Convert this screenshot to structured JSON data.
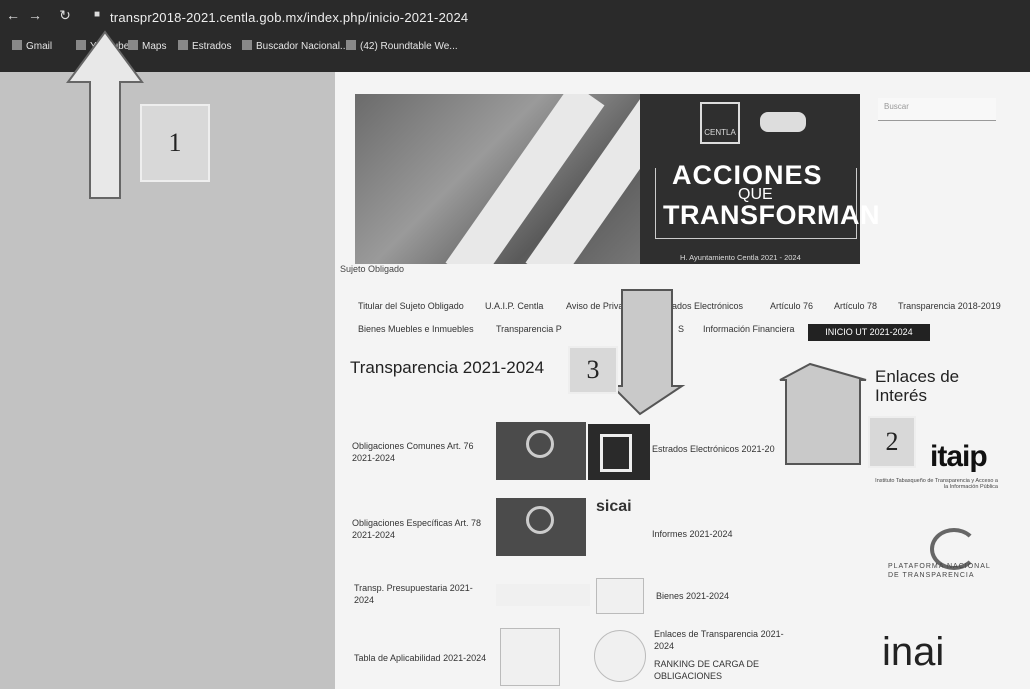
{
  "browser": {
    "url": "transpr2018-2021.centla.gob.mx/index.php/inicio-2021-2024",
    "bookmarks": [
      "Gmail",
      "YouTube",
      "Maps",
      "Estrados",
      "Buscador Nacional...",
      "(42) Roundtable We..."
    ]
  },
  "banner": {
    "line1": "ACCIONES",
    "line2": "QUE",
    "line3": "TRANSFORMAN",
    "footer": "H. Ayuntamiento Centla 2021 - 2024",
    "logo_text": "CENTLA"
  },
  "search": {
    "placeholder": "Buscar"
  },
  "sujeto_label": "Sujeto Obligado",
  "menu": {
    "row1": [
      "Titular del Sujeto Obligado",
      "U.A.I.P. Centla",
      "Aviso de Privac",
      "Estrados Electrónicos",
      "Artículo 76",
      "Artículo 78",
      "Transparencia 2018-2019"
    ],
    "row2": [
      "Bienes Muebles e Inmuebles",
      "Transparencia P",
      "S",
      "Información Financiera"
    ],
    "active": "INICIO UT 2021-2024"
  },
  "page_title": "Transparencia 2021-2024",
  "enlaces_title": "Enlaces de Interés",
  "rows": [
    {
      "left": "Obligaciones Comunes Art. 76 2021-2024",
      "right": "Estrados Electrónicos 2021-20"
    },
    {
      "left": "Obligaciones Específicas Art. 78 2021-2024",
      "right": "Informes 2021-2024"
    },
    {
      "left": "Transp. Presupuestaria 2021-2024",
      "right": "Bienes 2021-2024"
    },
    {
      "left": "Tabla de Aplicabilidad 2021-2024",
      "right": "Enlaces de Transparencia 2021-2024",
      "right2": "RANKING DE CARGA DE OBLIGACIONES"
    }
  ],
  "logos": {
    "itaip": "itaip",
    "itaip_sub": "Instituto Tabasqueño de Transparencia y Acceso a la Información Pública",
    "pnt": "PLATAFORMA NACIONAL DE TRANSPARENCIA",
    "inai": "inai",
    "sicai": "sicai"
  },
  "annotations": [
    "1",
    "2",
    "3"
  ]
}
